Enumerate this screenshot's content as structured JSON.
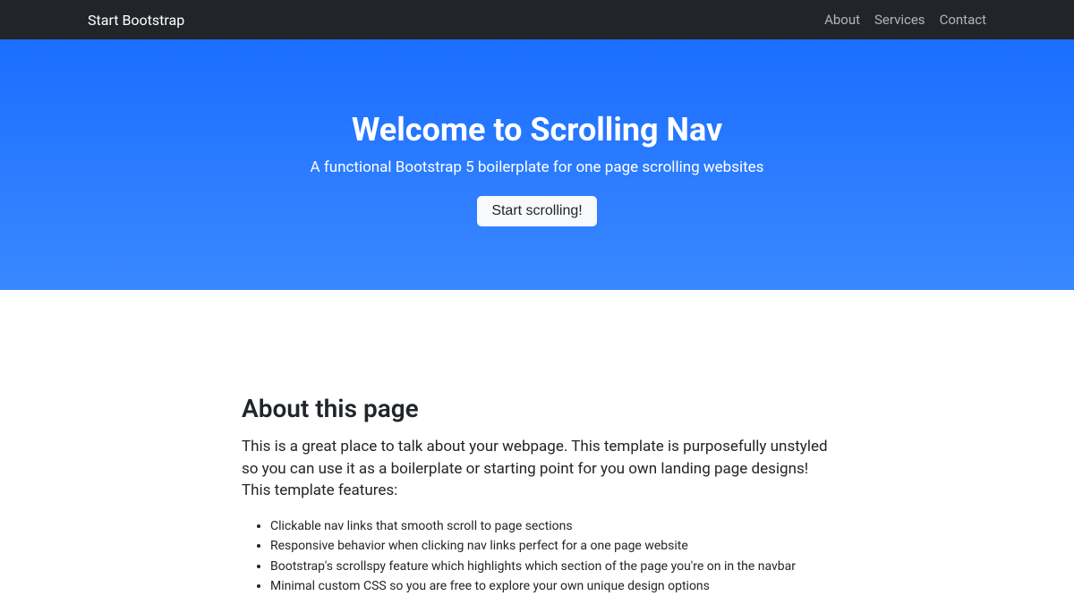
{
  "nav": {
    "brand": "Start Bootstrap",
    "links": [
      {
        "label": "About"
      },
      {
        "label": "Services"
      },
      {
        "label": "Contact"
      }
    ]
  },
  "hero": {
    "title": "Welcome to Scrolling Nav",
    "subtitle": "A functional Bootstrap 5 boilerplate for one page scrolling websites",
    "button": "Start scrolling!"
  },
  "about": {
    "heading": "About this page",
    "lead": "This is a great place to talk about your webpage. This template is purposefully unstyled so you can use it as a boilerplate or starting point for you own landing page designs! This template features:",
    "features": [
      "Clickable nav links that smooth scroll to page sections",
      "Responsive behavior when clicking nav links perfect for a one page website",
      "Bootstrap's scrollspy feature which highlights which section of the page you're on in the navbar",
      "Minimal custom CSS so you are free to explore your own unique design options"
    ]
  }
}
